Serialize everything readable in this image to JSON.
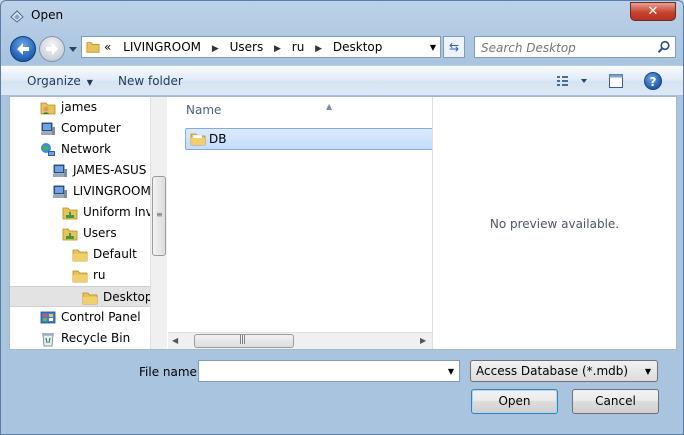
{
  "window": {
    "title": "Open",
    "close_symbol": "✕"
  },
  "address_bar": {
    "overflow_indicator": "«",
    "breadcrumbs": [
      "LIVINGROOM",
      "Users",
      "ru",
      "Desktop"
    ],
    "separator": "▶"
  },
  "search": {
    "placeholder": "Search Desktop"
  },
  "toolbar": {
    "organize_label": "Organize",
    "new_folder_label": "New folder",
    "help_label": "?"
  },
  "nav_tree": [
    {
      "label": "james",
      "icon": "user-folder-icon",
      "selected": false
    },
    {
      "label": "Computer",
      "icon": "computer-icon",
      "selected": false
    },
    {
      "label": "Network",
      "icon": "network-icon",
      "selected": false
    },
    {
      "label": "JAMES-ASUS",
      "icon": "computer-icon",
      "selected": false
    },
    {
      "label": "LIVINGROOM",
      "icon": "computer-icon",
      "selected": false
    },
    {
      "label": "Uniform Invo",
      "icon": "shared-folder-icon",
      "selected": false
    },
    {
      "label": "Users",
      "icon": "shared-folder-icon",
      "selected": false
    },
    {
      "label": "Default",
      "icon": "folder-icon",
      "selected": false
    },
    {
      "label": "ru",
      "icon": "folder-icon",
      "selected": false
    },
    {
      "label": "Desktop",
      "icon": "folder-icon",
      "selected": true
    },
    {
      "label": "Control Panel",
      "icon": "control-panel-icon",
      "selected": false
    },
    {
      "label": "Recycle Bin",
      "icon": "recycle-bin-icon",
      "selected": false
    }
  ],
  "file_list": {
    "column_header": "Name",
    "items": [
      {
        "name": "DB",
        "icon": "folder-icon",
        "selected": true
      }
    ]
  },
  "preview": {
    "message": "No preview available."
  },
  "footer": {
    "file_name_label": "File name:",
    "file_name_value": "",
    "file_type_selected": "Access Database (*.mdb)",
    "open_label": "Open",
    "cancel_label": "Cancel"
  },
  "colors": {
    "selection": "#c2dcfd",
    "selection_border": "#84acdd",
    "accent": "#1f5fb5"
  }
}
